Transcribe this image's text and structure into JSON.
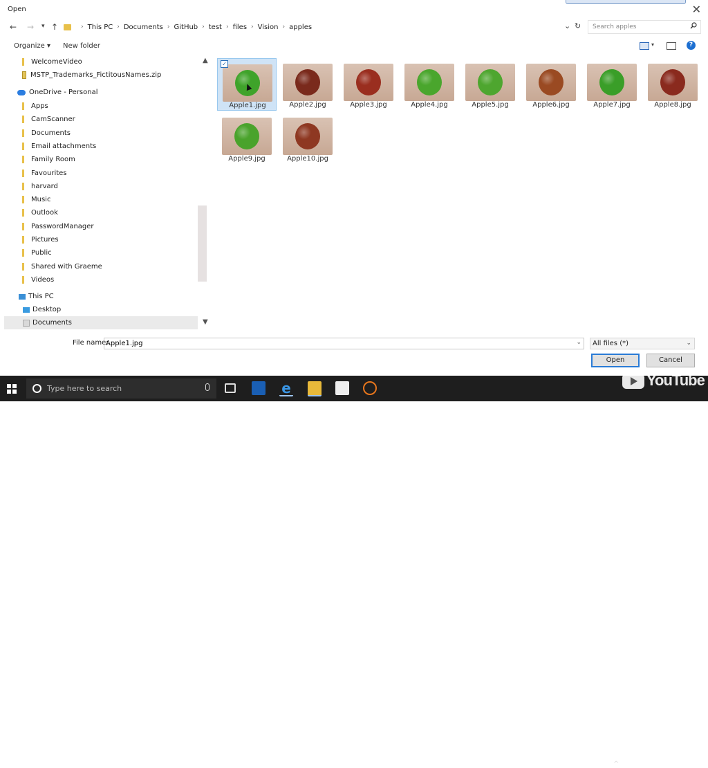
{
  "window": {
    "title": "Open",
    "close_glyph": "✕"
  },
  "nav_buttons": {
    "back": "←",
    "forward": "→",
    "recent": "▾",
    "up": "↑"
  },
  "address": {
    "crumbs": [
      "This PC",
      "Documents",
      "GitHub",
      "test",
      "files",
      "Vision",
      "apples"
    ],
    "dropdown_glyph": "⌄",
    "refresh_glyph": "↻"
  },
  "search": {
    "placeholder": "Search apples",
    "icon": "search-icon"
  },
  "toolbar": {
    "organize_label": "Organize ▾",
    "new_folder_label": "New folder",
    "help_label": "?"
  },
  "nav_pane": {
    "top_items": [
      "WelcomeVideo",
      "MSTP_Trademarks_FictitousNames.zip"
    ],
    "onedrive_label": "OneDrive - Personal",
    "onedrive_items": [
      "Apps",
      "CamScanner",
      "Documents",
      "Email attachments",
      "Family Room",
      "Favourites",
      "harvard",
      "Music",
      "Outlook",
      "PasswordManager",
      "Pictures",
      "Public",
      "Shared with Graeme",
      "Videos"
    ],
    "this_pc_label": "This PC",
    "this_pc_items": [
      "Desktop",
      "Documents"
    ],
    "selected_item": "Documents"
  },
  "files": [
    {
      "name": "Apple1.jpg",
      "color": "#3fa32a",
      "selected": true
    },
    {
      "name": "Apple2.jpg",
      "color": "#7a2a1c",
      "selected": false
    },
    {
      "name": "Apple3.jpg",
      "color": "#9a2e1f",
      "selected": false
    },
    {
      "name": "Apple4.jpg",
      "color": "#4aa62d",
      "selected": false
    },
    {
      "name": "Apple5.jpg",
      "color": "#4ea62f",
      "selected": false
    },
    {
      "name": "Apple6.jpg",
      "color": "#9a4a22",
      "selected": false
    },
    {
      "name": "Apple7.jpg",
      "color": "#3a9e28",
      "selected": false
    },
    {
      "name": "Apple8.jpg",
      "color": "#8a2a1e",
      "selected": false
    },
    {
      "name": "Apple9.jpg",
      "color": "#4aa32c",
      "selected": false
    },
    {
      "name": "Apple10.jpg",
      "color": "#8e3822",
      "selected": false
    }
  ],
  "footer": {
    "file_name_label": "File name:",
    "file_name_value": "Apple1.jpg",
    "filter_value": "All files (*)",
    "open_label": "Open",
    "cancel_label": "Cancel",
    "dropdown_glyph": "⌄"
  },
  "taskbar": {
    "search_placeholder": "Type here to search",
    "watermark": "YouTube",
    "tray_up": "^"
  }
}
